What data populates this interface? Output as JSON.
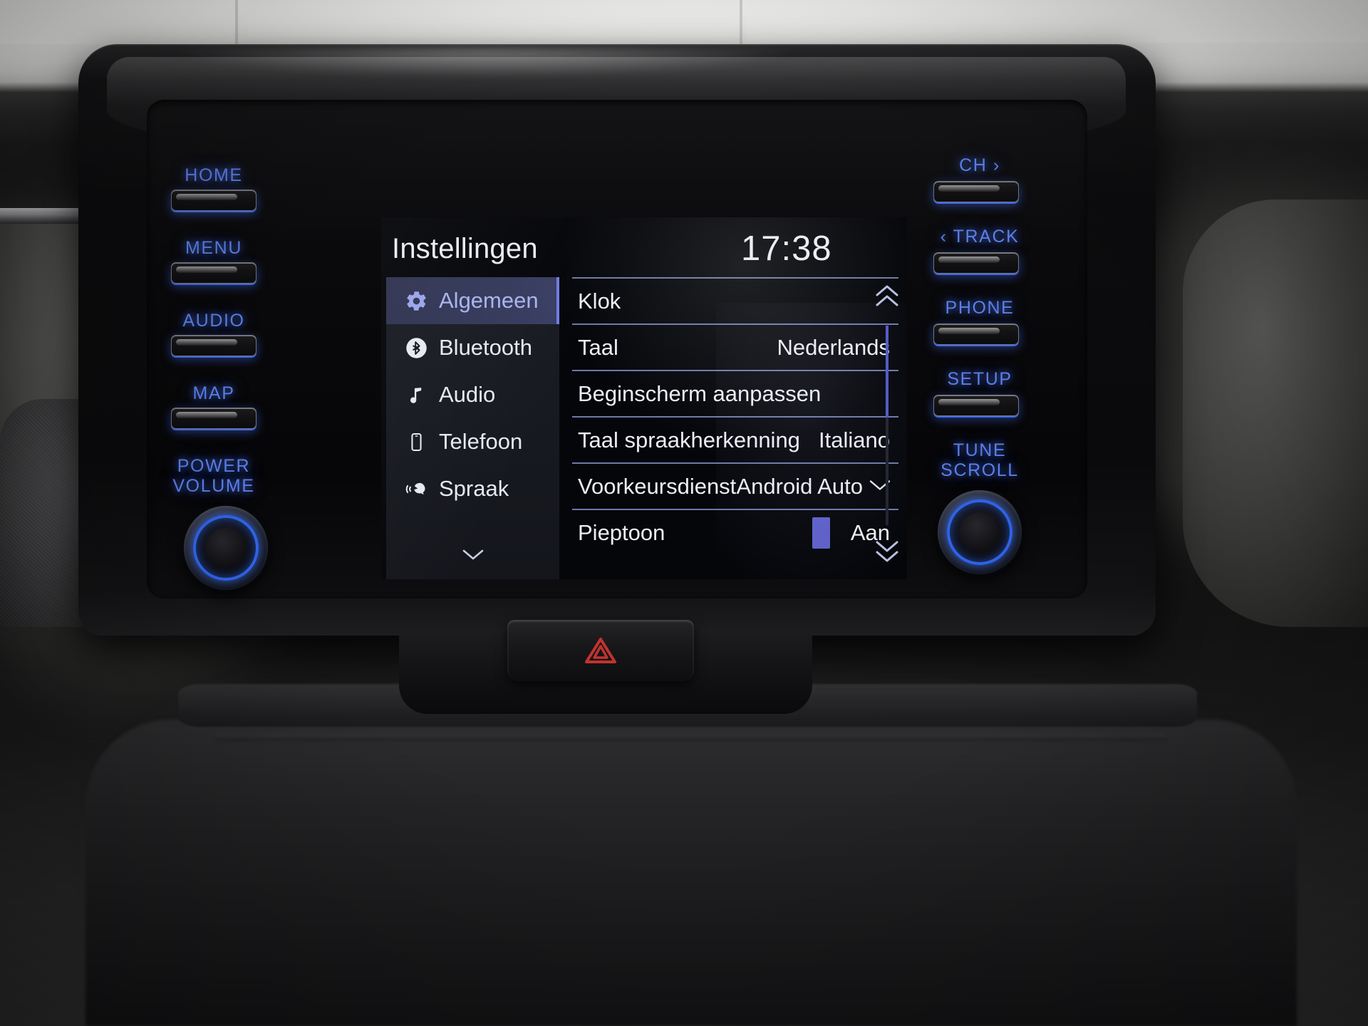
{
  "device": {
    "name": "Toyota Yaris touchscreen infotainment head unit",
    "hazard_icon": "hazard-triangle-icon",
    "hazard_color": "#c2332e"
  },
  "left_buttons": [
    {
      "label": "HOME",
      "icon": "home-hard-button"
    },
    {
      "label": "MENU",
      "icon": "menu-hard-button"
    },
    {
      "label": "AUDIO",
      "icon": "audio-hard-button"
    },
    {
      "label": "MAP",
      "icon": "map-hard-button"
    }
  ],
  "left_knob": {
    "label_line1": "POWER",
    "label_line2": "VOLUME",
    "icon": "power-volume-knob"
  },
  "right_buttons": [
    {
      "label": "CH  ›",
      "icon": "channel-up-hard-button"
    },
    {
      "label": "‹ TRACK",
      "icon": "track-back-hard-button"
    },
    {
      "label": "PHONE",
      "icon": "phone-hard-button"
    },
    {
      "label": "SETUP",
      "icon": "setup-hard-button"
    }
  ],
  "right_knob": {
    "label_line1": "TUNE",
    "label_line2": "SCROLL",
    "icon": "tune-scroll-knob"
  },
  "screen": {
    "title": "Instellingen",
    "clock": "17:38",
    "mute_icon": "mute-speaker-icon",
    "accent": "#6f7ce0",
    "sidebar": {
      "items": [
        {
          "label": "Algemeen",
          "icon": "gear-icon",
          "active": true
        },
        {
          "label": "Bluetooth",
          "icon": "bluetooth-icon",
          "active": false
        },
        {
          "label": "Audio",
          "icon": "music-note-icon",
          "active": false
        },
        {
          "label": "Telefoon",
          "icon": "smartphone-icon",
          "active": false
        },
        {
          "label": "Spraak",
          "icon": "voice-speech-icon",
          "active": false
        }
      ],
      "more_icon": "chevron-down-icon"
    },
    "list": {
      "rows": [
        {
          "label": "Klok",
          "value": "",
          "control": "none"
        },
        {
          "label": "Taal",
          "value": "Nederlands",
          "control": "none"
        },
        {
          "label": "Beginscherm aanpassen",
          "value": "",
          "control": "none"
        },
        {
          "label": "Taal spraakherkenning",
          "value": "Italiano",
          "control": "none"
        },
        {
          "label": "Voorkeursdienst",
          "value": "Android Auto",
          "control": "dropdown"
        },
        {
          "label": "Pieptoon",
          "value": "Aan",
          "control": "toggle"
        }
      ]
    },
    "scroll": {
      "up_icon": "double-chevron-up-icon",
      "down_icon": "double-chevron-down-icon",
      "position_percent": 12
    }
  }
}
